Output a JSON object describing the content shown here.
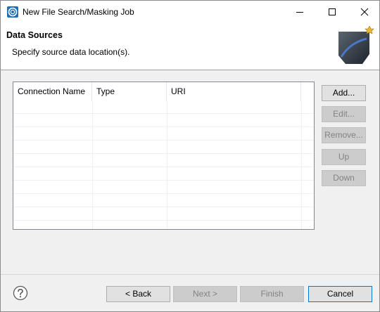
{
  "window": {
    "title": "New File Search/Masking Job"
  },
  "banner": {
    "title": "Data Sources",
    "description": "Specify source data location(s)."
  },
  "table": {
    "columns": [
      "Connection Name",
      "Type",
      "URI"
    ],
    "rows": []
  },
  "side_buttons": {
    "add": "Add...",
    "edit": "Edit...",
    "remove": "Remove...",
    "up": "Up",
    "down": "Down"
  },
  "footer": {
    "back": "< Back",
    "next": "Next >",
    "finish": "Finish",
    "cancel": "Cancel"
  },
  "icons": {
    "app": "app-logo-icon",
    "help": "help-icon",
    "minimize": "minimize-icon",
    "maximize": "maximize-icon",
    "close": "close-icon",
    "banner": "wizard-banner-graphic"
  },
  "colors": {
    "accent_border": "#0078d7",
    "app_icon_blue": "#1f6fb6"
  }
}
